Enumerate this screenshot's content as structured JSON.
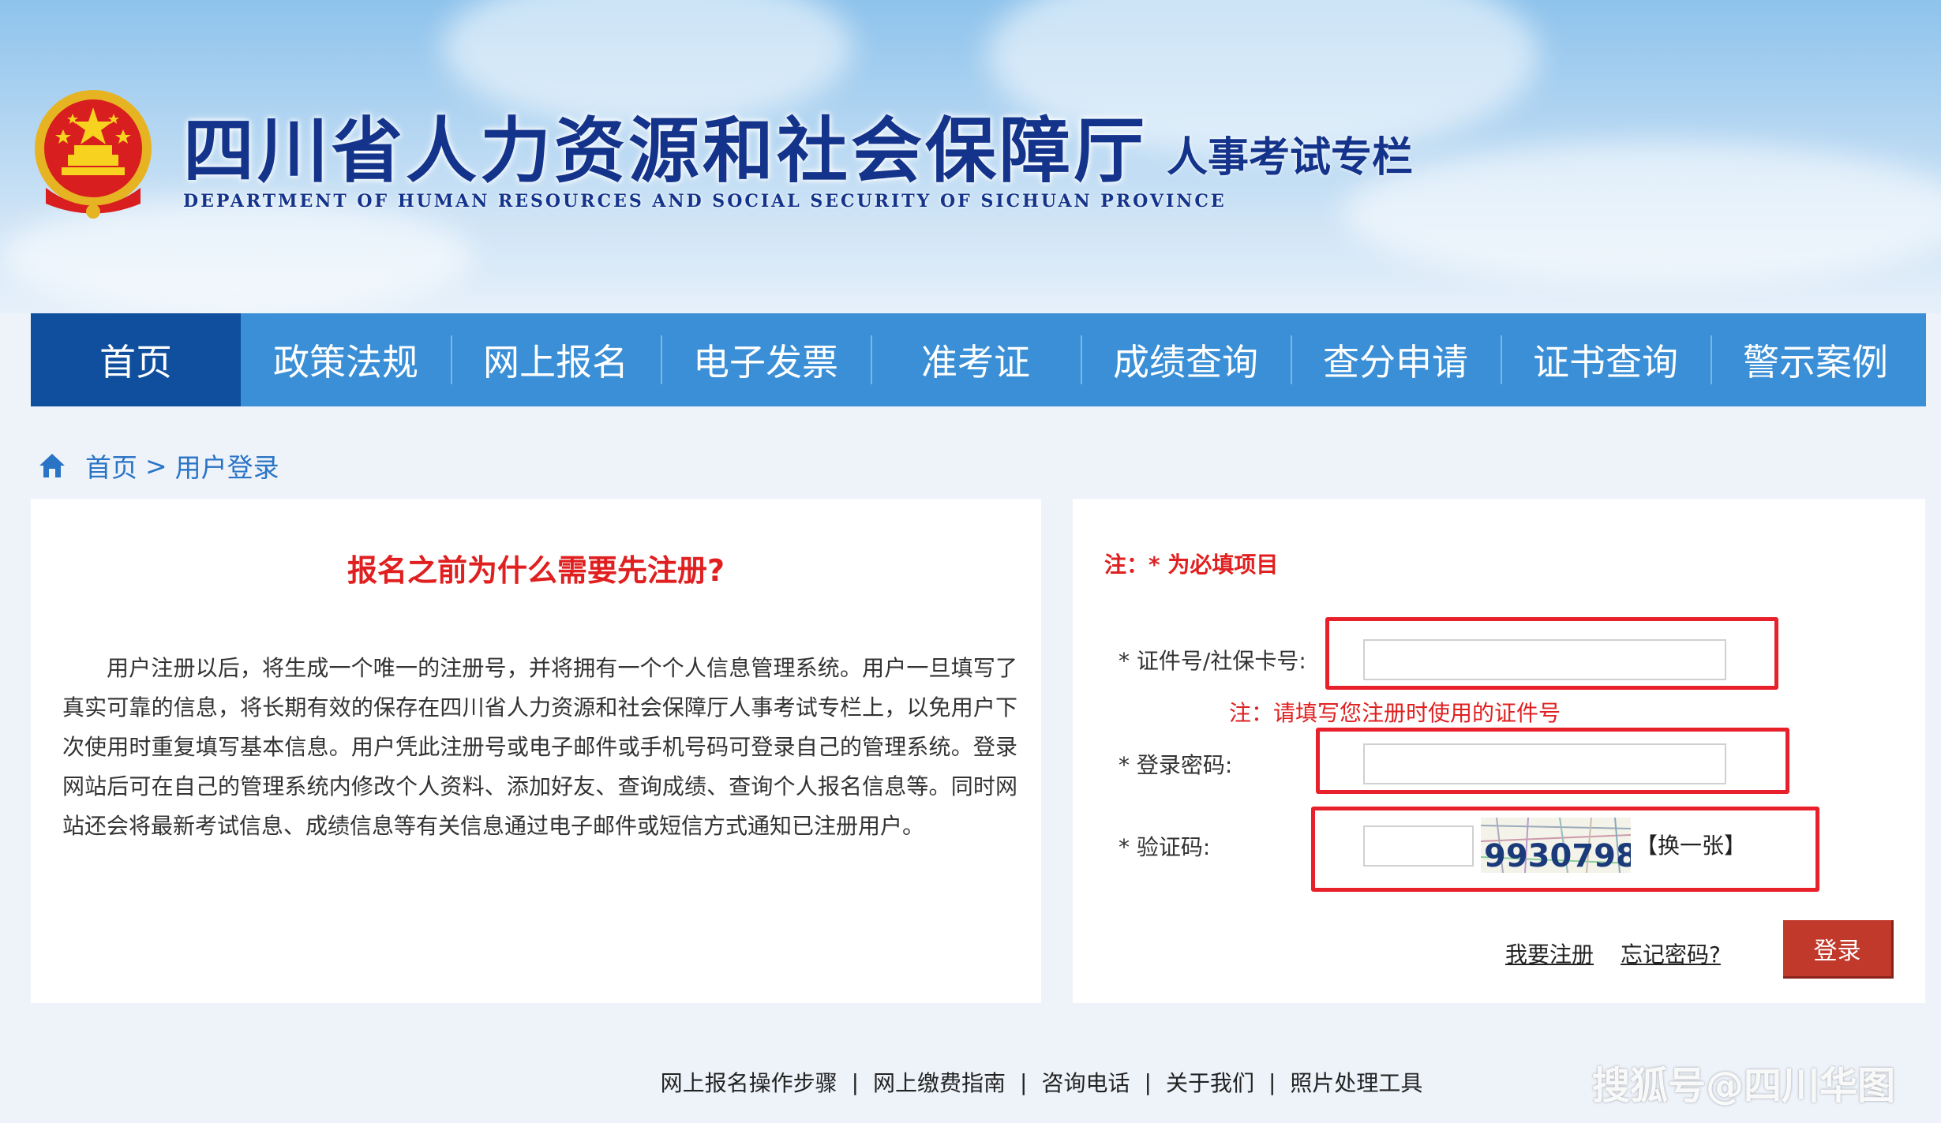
{
  "header": {
    "site_title": "四川省人力资源和社会保障厅",
    "site_subtitle": "DEPARTMENT OF HUMAN RESOURCES AND SOCIAL SECURITY OF SICHUAN PROVINCE",
    "section_title": "人事考试专栏"
  },
  "nav": {
    "items": [
      "首页",
      "政策法规",
      "网上报名",
      "电子发票",
      "准考证",
      "成绩查询",
      "查分申请",
      "证书查询",
      "警示案例"
    ],
    "active_index": 0
  },
  "breadcrumb": {
    "home": "首页",
    "separator": ">",
    "current": "用户登录"
  },
  "info": {
    "title": "报名之前为什么需要先注册?",
    "body": "用户注册以后，将生成一个唯一的注册号，并将拥有一个个人信息管理系统。用户一旦填写了真实可靠的信息，将长期有效的保存在四川省人力资源和社会保障厅人事考试专栏上，以免用户下次使用时重复填写基本信息。用户凭此注册号或电子邮件或手机号码可登录自己的管理系统。登录网站后可在自己的管理系统内修改个人资料、添加好友、查询成绩、查询个人报名信息等。同时网站还会将最新考试信息、成绩信息等有关信息通过电子邮件或短信方式通知已注册用户。"
  },
  "login": {
    "required_note": "注：* 为必填项目",
    "id_label": "* 证件号/社保卡号:",
    "id_value": "",
    "id_hint": "注：请填写您注册时使用的证件号",
    "password_label": "* 登录密码:",
    "password_value": "",
    "captcha_label": "* 验证码:",
    "captcha_value": "",
    "captcha_text": "9930798",
    "captcha_refresh": "【换一张】",
    "register_link": "我要注册",
    "forgot_link": "忘记密码?",
    "login_button": "登录"
  },
  "footer": {
    "links": [
      "网上报名操作步骤",
      "网上缴费指南",
      "咨询电话",
      "关于我们",
      "照片处理工具"
    ],
    "separator": "|"
  },
  "watermark": "搜狐号@四川华图",
  "colors": {
    "nav_bg": "#3a8fd6",
    "nav_active": "#0f4f9e",
    "title_blue": "#14348c",
    "alert_red": "#e02020",
    "highlight_red": "#e8202a",
    "login_button": "#c0392b"
  }
}
